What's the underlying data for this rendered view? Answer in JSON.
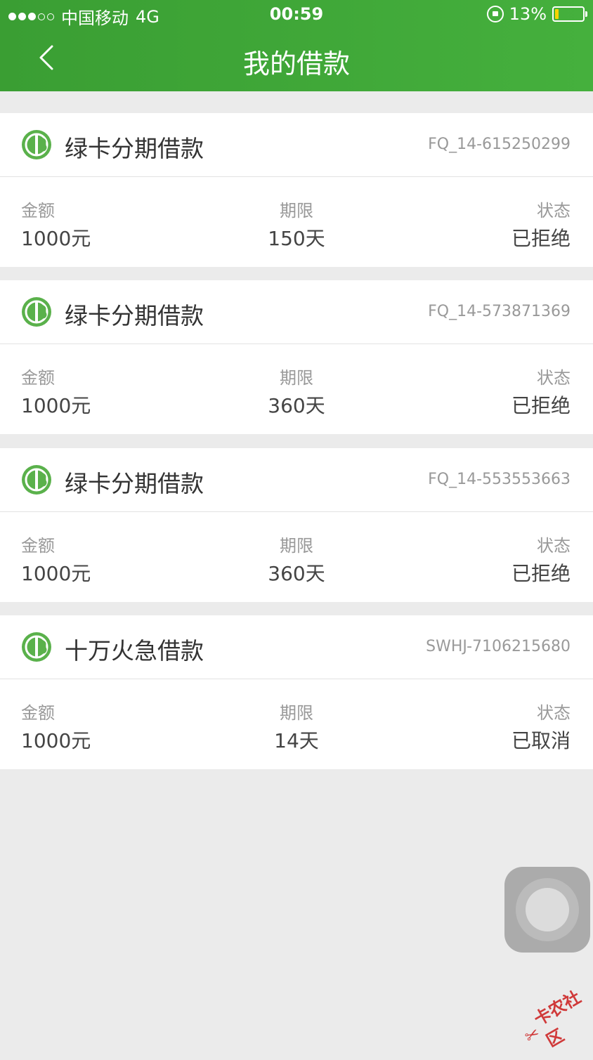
{
  "status": {
    "carrier": "中国移动",
    "network": "4G",
    "time": "00:59",
    "battery": "13%"
  },
  "nav": {
    "title": "我的借款",
    "back_icon": "chevron-left-icon"
  },
  "labels": {
    "amount": "金额",
    "term": "期限",
    "state": "状态"
  },
  "loans": [
    {
      "name": "绿卡分期借款",
      "code": "FQ_14-615250299",
      "amount": "1000元",
      "term": "150天",
      "state": "已拒绝"
    },
    {
      "name": "绿卡分期借款",
      "code": "FQ_14-573871369",
      "amount": "1000元",
      "term": "360天",
      "state": "已拒绝"
    },
    {
      "name": "绿卡分期借款",
      "code": "FQ_14-553553663",
      "amount": "1000元",
      "term": "360天",
      "state": "已拒绝"
    },
    {
      "name": "十万火急借款",
      "code": "SWHJ-7106215680",
      "amount": "1000元",
      "term": "14天",
      "state": "已取消"
    }
  ],
  "watermark": "卡农社区",
  "colors": {
    "brand_green": "#45b03d",
    "logo_green": "#5ab14b"
  }
}
